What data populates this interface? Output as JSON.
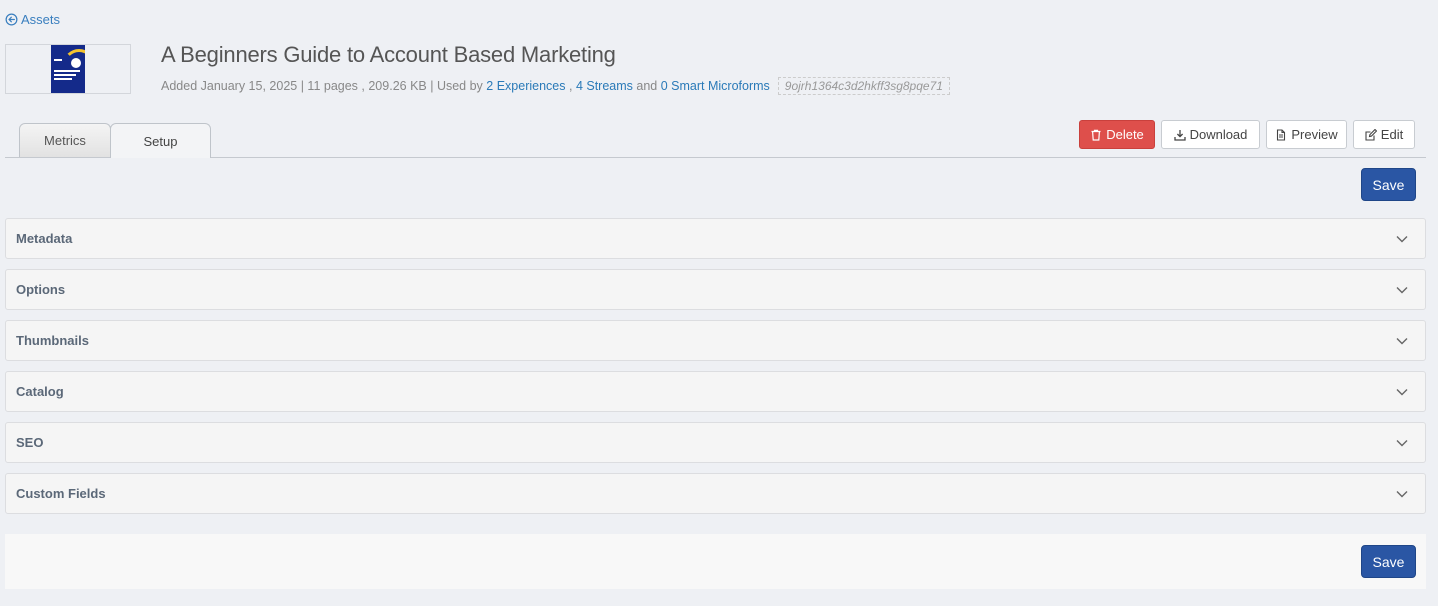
{
  "nav": {
    "back_label": "Assets"
  },
  "asset": {
    "title": "A Beginners Guide to Account Based Marketing",
    "added": "Added January 15, 2025",
    "pages": "11 pages",
    "size": "209.26 KB",
    "used_by_label": "Used by",
    "experiences_link": "2 Experiences",
    "streams_link": "4 Streams",
    "and_text": "and",
    "microforms_link": "0 Smart Microforms",
    "id": "9ojrh1364c3d2hkff3sg8pqe71"
  },
  "tabs": [
    {
      "label": "Metrics",
      "active": false
    },
    {
      "label": "Setup",
      "active": true
    }
  ],
  "actions": {
    "delete": "Delete",
    "download": "Download",
    "preview": "Preview",
    "edit": "Edit"
  },
  "save_label": "Save",
  "panels": [
    {
      "label": "Metadata"
    },
    {
      "label": "Options"
    },
    {
      "label": "Thumbnails"
    },
    {
      "label": "Catalog"
    },
    {
      "label": "SEO"
    },
    {
      "label": "Custom Fields"
    }
  ],
  "colors": {
    "accent": "#2a56a4",
    "danger": "#de4f4b",
    "link": "#2a7ab8",
    "background": "#eef0f4"
  },
  "icons": {
    "back": "arrow-left-circle-icon",
    "delete": "trash-icon",
    "download": "download-icon",
    "preview": "document-icon",
    "edit": "edit-icon",
    "expand": "chevron-down-icon"
  }
}
